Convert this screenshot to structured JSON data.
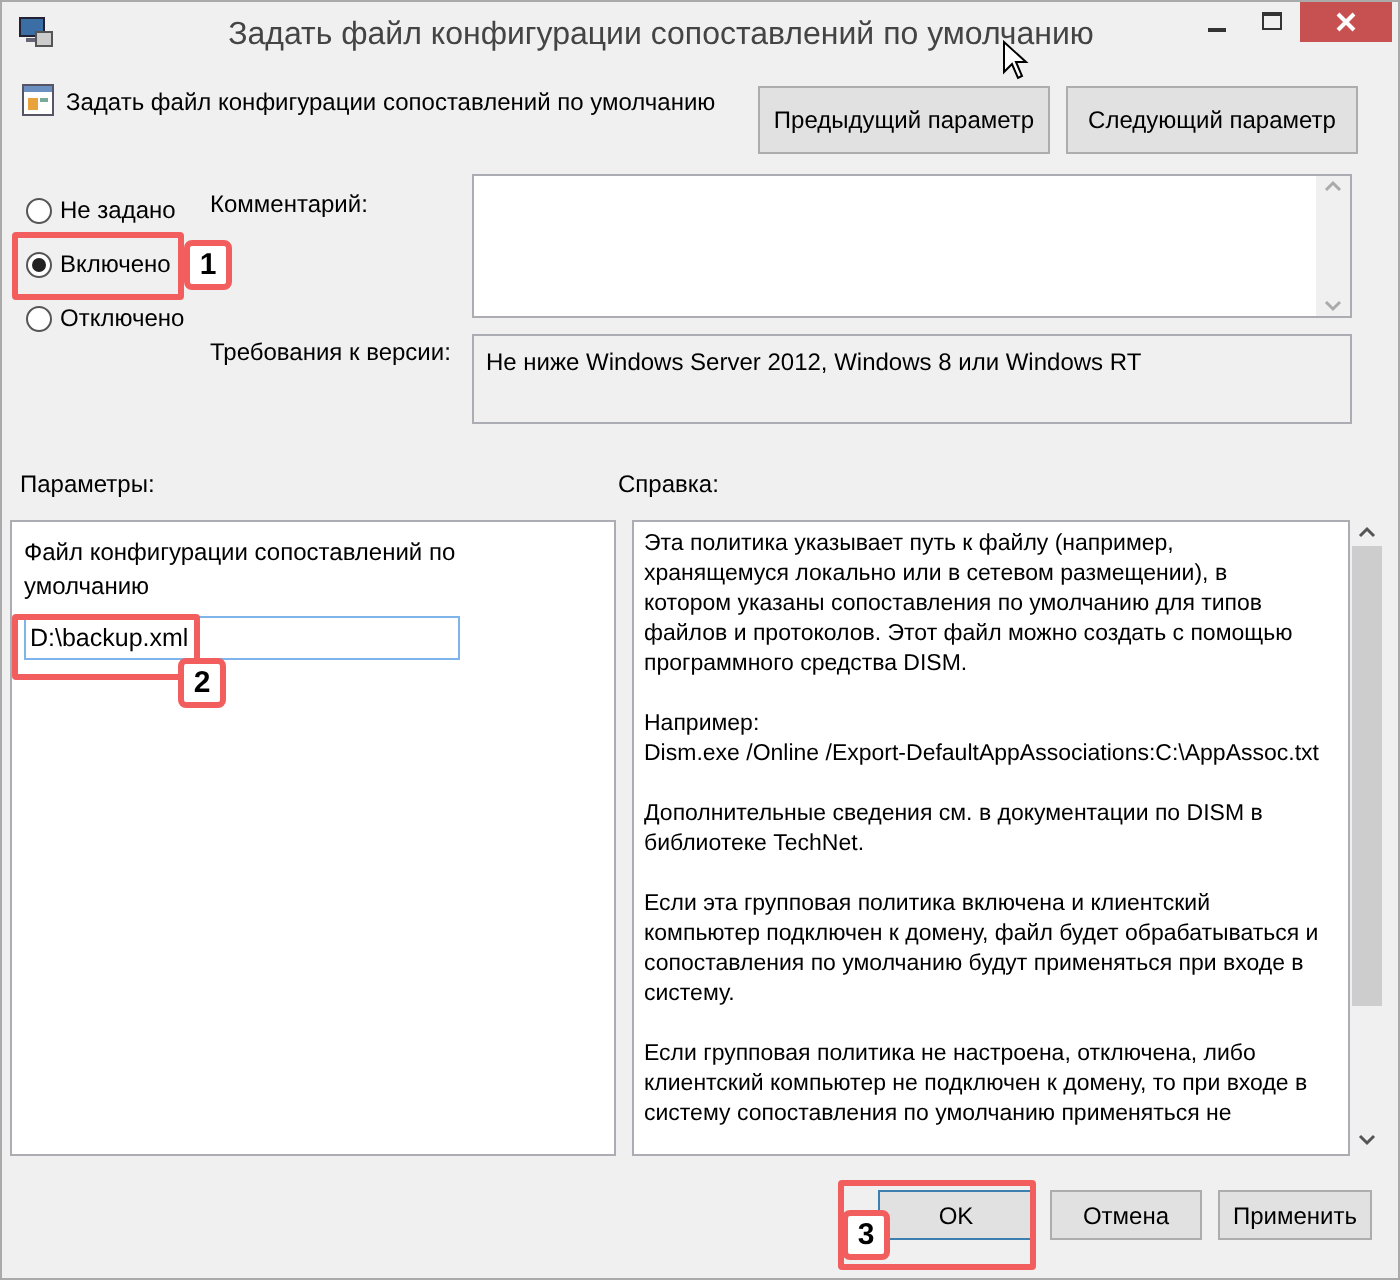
{
  "window": {
    "title": "Задать файл конфигурации сопоставлений по умолчанию"
  },
  "policy": {
    "name": "Задать файл конфигурации сопоставлений по умолчанию"
  },
  "nav_buttons": [
    "Предыдущий параметр",
    "Следующий параметр"
  ],
  "states": [
    {
      "label": "Не задано",
      "selected": false
    },
    {
      "label": "Включено",
      "selected": true
    },
    {
      "label": "Отключено",
      "selected": false
    }
  ],
  "comment": {
    "label": "Комментарий:"
  },
  "version": {
    "label": "Требования к версии:",
    "value": "Не ниже Windows Server 2012, Windows 8 или Windows RT"
  },
  "options": {
    "label": "Параметры:",
    "field_label": "Файл конфигурации сопоставлений по умолчанию",
    "value": "D:\\backup.xml"
  },
  "help": {
    "label": "Справка:",
    "paragraphs": [
      "Эта политика указывает путь к файлу (например, хранящемуся локально или в сетевом размещении), в котором указаны сопоставления по умолчанию для типов файлов и протоколов. Этот файл можно создать с помощью программного средства DISM.",
      "Например:\nDism.exe /Online /Export-DefaultAppAssociations:C:\\AppAssoc.txt",
      "Дополнительные сведения см. в документации по DISM в библиотеке TechNet.",
      "Если эта групповая политика включена и клиентский компьютер подключен к домену, файл будет обрабатываться и сопоставления по умолчанию будут применяться при входе в систему.",
      "Если групповая политика не настроена, отключена, либо клиентский компьютер не подключен к домену, то при входе в систему сопоставления по умолчанию применяться не"
    ]
  },
  "buttons": [
    {
      "label": "OK",
      "default": true
    },
    {
      "label": "Отмена",
      "default": false
    },
    {
      "label": "Применить",
      "default": false
    }
  ],
  "callouts": [
    {
      "number": "1"
    },
    {
      "number": "2"
    },
    {
      "number": "3"
    }
  ]
}
